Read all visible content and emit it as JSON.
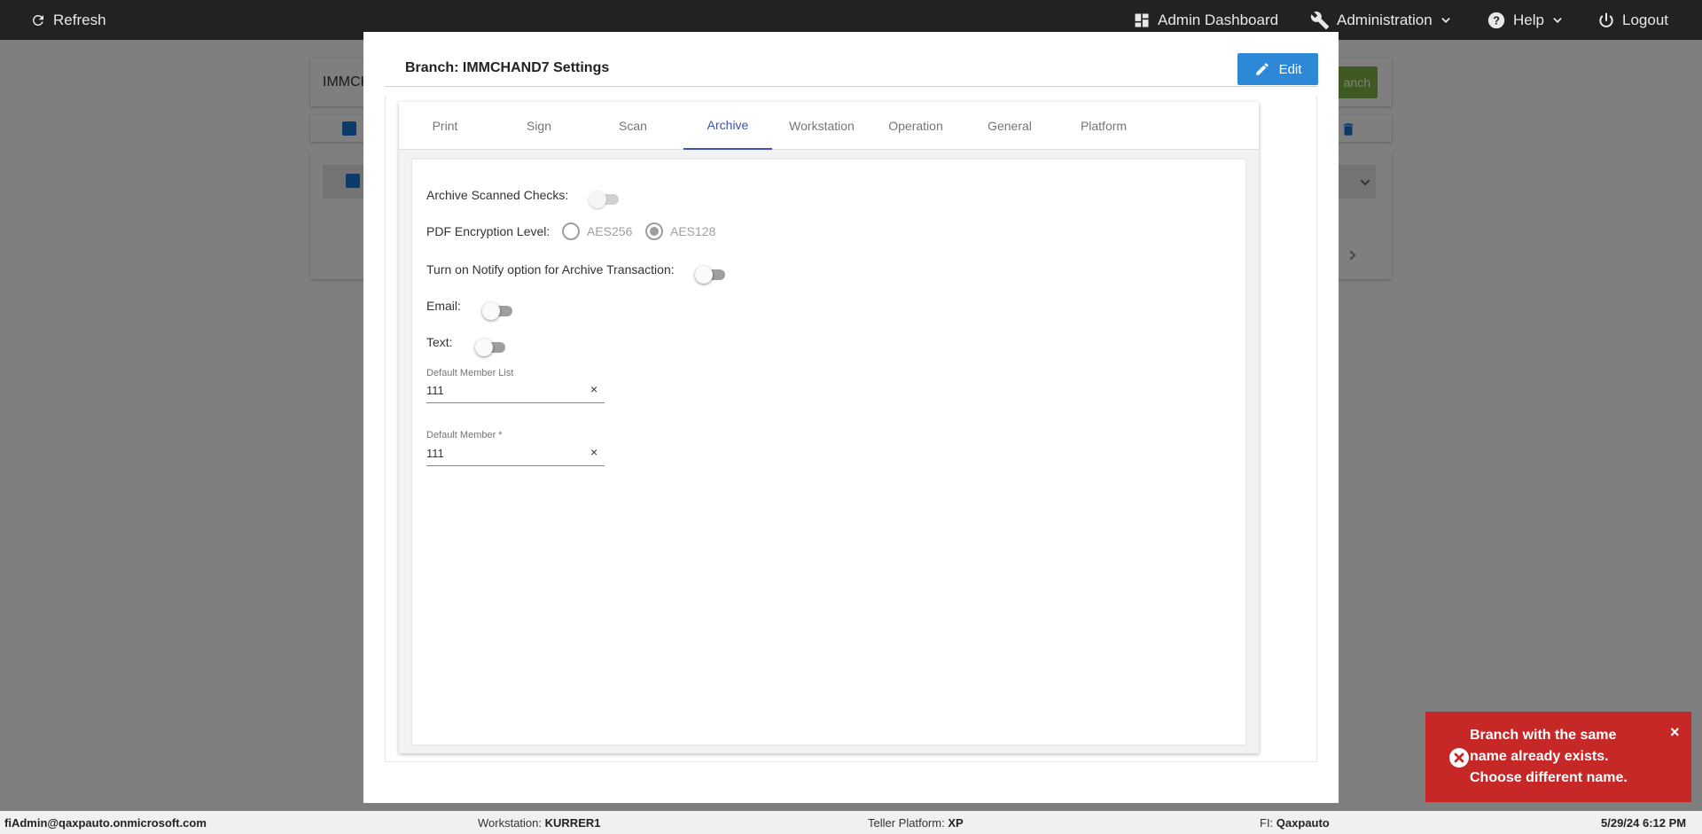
{
  "topbar": {
    "refresh_label": "Refresh",
    "admin_dashboard_label": "Admin Dashboard",
    "administration_label": "Administration",
    "help_label": "Help",
    "logout_label": "Logout"
  },
  "background": {
    "input_text": "IMMCH",
    "green_button_partial": "anch"
  },
  "modal": {
    "title": "Branch: IMMCHAND7 Settings",
    "edit_label": "Edit",
    "tabs": [
      {
        "label": "Print"
      },
      {
        "label": "Sign"
      },
      {
        "label": "Scan"
      },
      {
        "label": "Archive",
        "active": true
      },
      {
        "label": "Workstation"
      },
      {
        "label": "Operation"
      },
      {
        "label": "General"
      },
      {
        "label": "Platform"
      }
    ],
    "archive": {
      "archive_scanned_checks_label": "Archive Scanned Checks:",
      "archive_scanned_checks_on": false,
      "pdf_encryption_label": "PDF Encryption Level:",
      "pdf_options": [
        {
          "label": "AES256",
          "selected": false
        },
        {
          "label": "AES128",
          "selected": true
        }
      ],
      "notify_label": "Turn on Notify option for Archive Transaction:",
      "notify_on": false,
      "email_label": "Email:",
      "email_on": false,
      "text_label": "Text:",
      "text_on": false,
      "default_member_list_label": "Default Member List",
      "default_member_list_value": "111",
      "default_member_label": "Default Member *",
      "default_member_value": "111",
      "clear_glyph": "×"
    }
  },
  "toast": {
    "message": "Branch with the same name already exists. Choose different name.",
    "close_glyph": "×",
    "color": "#c62828"
  },
  "statusbar": {
    "user": "fiAdmin@qaxpauto.onmicrosoft.com",
    "workstation_label": "Workstation:",
    "workstation_value": "KURRER1",
    "platform_label": "Teller Platform:",
    "platform_value": "XP",
    "fi_label": "FI:",
    "fi_value": "Qaxpauto",
    "datetime": "5/29/24 6:12 PM"
  },
  "colors": {
    "accent": "#3f51b5",
    "edit_button": "#2e88d8",
    "topbar": "#222222"
  }
}
